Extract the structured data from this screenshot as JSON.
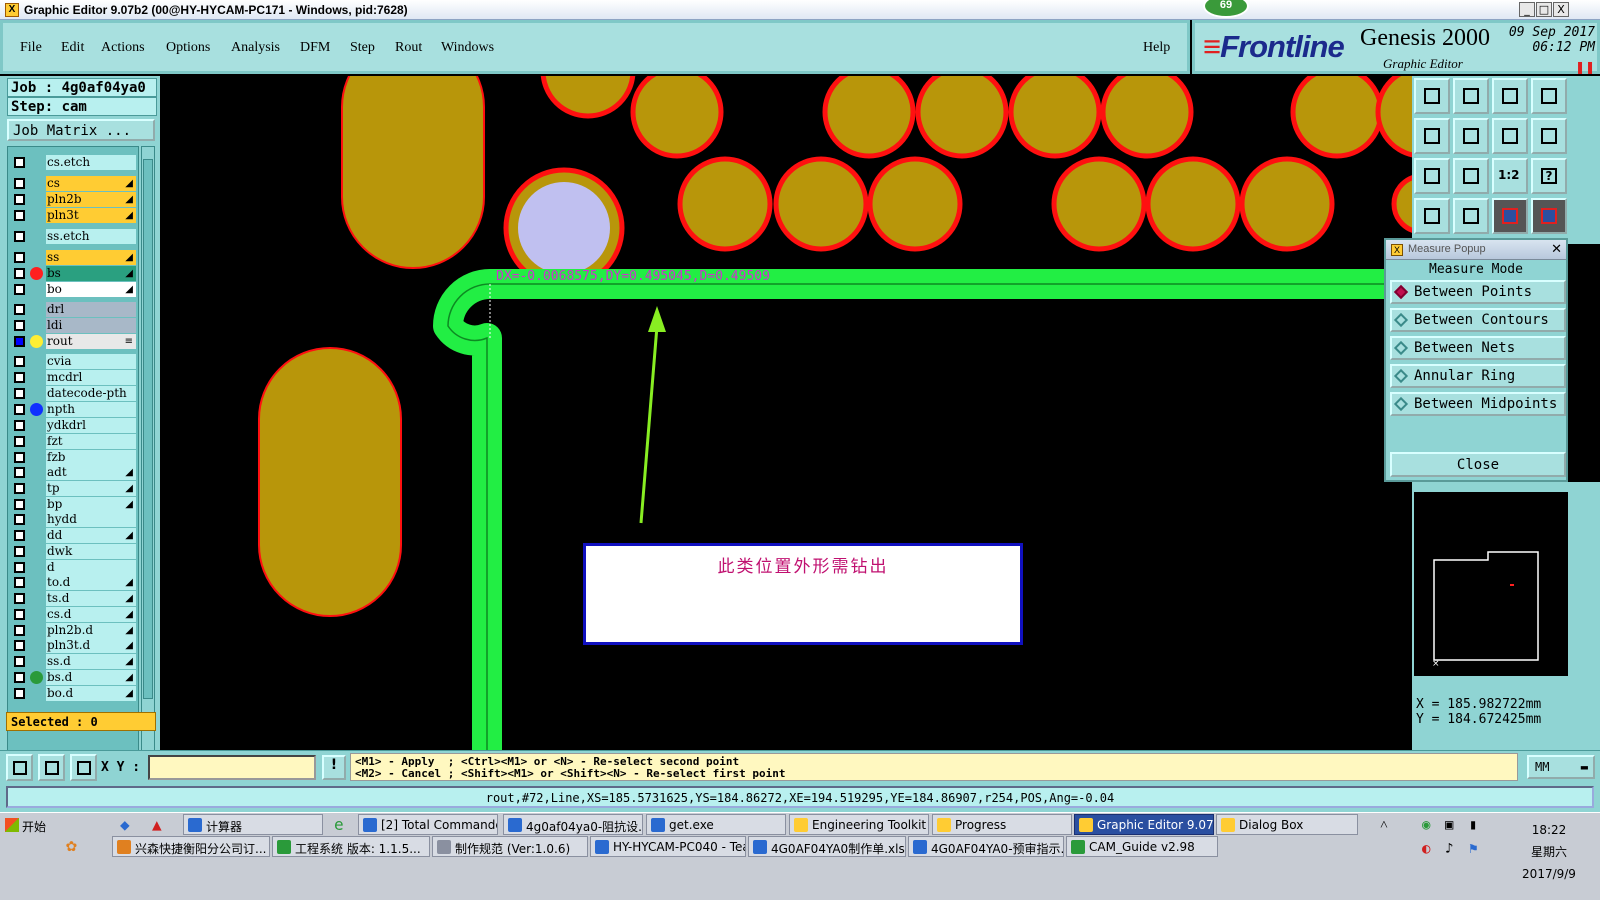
{
  "window": {
    "title": "Graphic Editor 9.07b2 (00@HY-HYCAM-PC171 - Windows, pid:7628)",
    "badge": "69",
    "minimize": "_",
    "maximize": "□",
    "close": "X"
  },
  "menu": {
    "items": [
      "File",
      "Edit",
      "Actions",
      "Options",
      "Analysis",
      "DFM",
      "Step",
      "Rout",
      "Windows"
    ],
    "help": "Help"
  },
  "brand": {
    "logo": "Frontline",
    "product": "Genesis 2000",
    "subtitle": "Graphic Editor",
    "date": "09 Sep 2017",
    "time": "06:12 PM"
  },
  "job": {
    "job_label": "Job : 4g0af04ya0",
    "step_label": "Step: cam",
    "matrix_button": "Job Matrix ..."
  },
  "layers": [
    {
      "name": "cs.etch",
      "color": "#b8f0ef",
      "dot": "",
      "arrow": ""
    },
    {
      "name": "cs",
      "color": "#ffcc33",
      "dot": "",
      "arrow": "◢"
    },
    {
      "name": "pln2b",
      "color": "#ffcc33",
      "dot": "",
      "arrow": "◢"
    },
    {
      "name": "pln3t",
      "color": "#ffcc33",
      "dot": "",
      "arrow": "◢"
    },
    {
      "name": "ss.etch",
      "color": "#b8f0ef",
      "dot": "",
      "arrow": ""
    },
    {
      "name": "ss",
      "color": "#ffcc33",
      "dot": "",
      "arrow": "◢"
    },
    {
      "name": "bs",
      "color": "#2aa080",
      "dot": "#ff2020",
      "arrow": "◢"
    },
    {
      "name": "bo",
      "color": "#ffffff",
      "dot": "",
      "arrow": "◢"
    },
    {
      "name": "drl",
      "color": "#a8b8c8",
      "dot": "",
      "arrow": ""
    },
    {
      "name": "ldi",
      "color": "#a8b8c8",
      "dot": "",
      "arrow": ""
    },
    {
      "name": "rout",
      "color": "#e8e8e8",
      "dot": "#ffee33",
      "arrow": "≡"
    },
    {
      "name": "cvia",
      "color": "#b8f0ef",
      "dot": "",
      "arrow": ""
    },
    {
      "name": "mcdrl",
      "color": "#b8f0ef",
      "dot": "",
      "arrow": ""
    },
    {
      "name": "datecode-pth",
      "color": "#b8f0ef",
      "dot": "",
      "arrow": ""
    },
    {
      "name": "npth",
      "color": "#b8f0ef",
      "dot": "#1030ff",
      "arrow": ""
    },
    {
      "name": "ydkdrl",
      "color": "#b8f0ef",
      "dot": "",
      "arrow": ""
    },
    {
      "name": "fzt",
      "color": "#b8f0ef",
      "dot": "",
      "arrow": ""
    },
    {
      "name": "fzb",
      "color": "#b8f0ef",
      "dot": "",
      "arrow": ""
    },
    {
      "name": "adt",
      "color": "#b8f0ef",
      "dot": "",
      "arrow": "◢"
    },
    {
      "name": "tp",
      "color": "#b8f0ef",
      "dot": "",
      "arrow": "◢"
    },
    {
      "name": "bp",
      "color": "#b8f0ef",
      "dot": "",
      "arrow": "◢"
    },
    {
      "name": "hydd",
      "color": "#b8f0ef",
      "dot": "",
      "arrow": ""
    },
    {
      "name": "dd",
      "color": "#b8f0ef",
      "dot": "",
      "arrow": "◢"
    },
    {
      "name": "dwk",
      "color": "#b8f0ef",
      "dot": "",
      "arrow": ""
    },
    {
      "name": "d",
      "color": "#b8f0ef",
      "dot": "",
      "arrow": ""
    },
    {
      "name": "to.d",
      "color": "#b8f0ef",
      "dot": "",
      "arrow": "◢"
    },
    {
      "name": "ts.d",
      "color": "#b8f0ef",
      "dot": "",
      "arrow": "◢"
    },
    {
      "name": "cs.d",
      "color": "#b8f0ef",
      "dot": "",
      "arrow": "◢"
    },
    {
      "name": "pln2b.d",
      "color": "#b8f0ef",
      "dot": "",
      "arrow": "◢"
    },
    {
      "name": "pln3t.d",
      "color": "#b8f0ef",
      "dot": "",
      "arrow": "◢"
    },
    {
      "name": "ss.d",
      "color": "#b8f0ef",
      "dot": "",
      "arrow": "◢"
    },
    {
      "name": "bs.d",
      "color": "#b8f0ef",
      "dot": "#2a9a3a",
      "arrow": "◢"
    },
    {
      "name": "bo.d",
      "color": "#b8f0ef",
      "dot": "",
      "arrow": "◢"
    }
  ],
  "selected_label": "Selected : 0",
  "canvas": {
    "measurement": "DX=-0.0068575,DY=0.495045,D=0.49509",
    "annotation": "此类位置外形需钻出",
    "colors": {
      "pad": "#b8960a",
      "pad_outline": "#ff1010",
      "rout": "#22ee44",
      "drill": "#c0c0f0"
    }
  },
  "measure_popup": {
    "title": "Measure Popup",
    "mode_label": "Measure Mode",
    "options": [
      "Between Points",
      "Between Contours",
      "Between Nets",
      "Annular Ring",
      "Between Midpoints"
    ],
    "selected_option": "Between Points",
    "close_label": "Close"
  },
  "tools": [
    "zoom-home-icon",
    "zoom-in-icon",
    "home-icon",
    "window-icon",
    "pan-left-icon",
    "pan-right-icon",
    "fit-icon",
    "s-icon",
    "fit-screen-icon",
    "move-icon",
    "scale-1-2-icon",
    "help-icon",
    "snap-icon",
    "pin-icon",
    "layer-a-icon",
    "layer-b-icon"
  ],
  "tool_text": {
    "scale": "1:2",
    "help": "?"
  },
  "coords": {
    "x": "X = 185.982722mm",
    "y": "Y = 184.672425mm"
  },
  "command": {
    "xy_label": "X Y :",
    "xy_value": "",
    "hint_line1": "<M1> - Apply  ; <Ctrl><M1> or <N> - Re-select second point",
    "hint_line2": "<M2> - Cancel ; <Shift><M1> or <Shift><N> - Re-select first point",
    "units": "MM",
    "excl": "!"
  },
  "status": "rout,#72,Line,XS=185.5731625,YS=184.86272,XE=194.519295,YE=184.86907,r254,POS,Ang=-0.04",
  "taskbar": {
    "start": "开始",
    "row1": [
      "计算器",
      "[2] Total Commander ...",
      "4g0af04ya0-阻抗设...",
      "get.exe",
      "Engineering Toolkit 9....",
      "Progress",
      "Graphic Editor 9.07...",
      "Dialog Box"
    ],
    "row2": [
      "兴森快捷衡阳分公司订...",
      "工程系统  版本: 1.1.5...",
      "制作规范 (Ver:1.0.6)",
      "HY-HYCAM-PC040 - Tea...",
      "4G0AF04YA0制作单.xls ...",
      "4G0AF04YA0-预审指示...",
      "CAM_Guide v2.98"
    ],
    "time": "18:22",
    "weekday": "星期六",
    "date": "2017/9/9"
  }
}
